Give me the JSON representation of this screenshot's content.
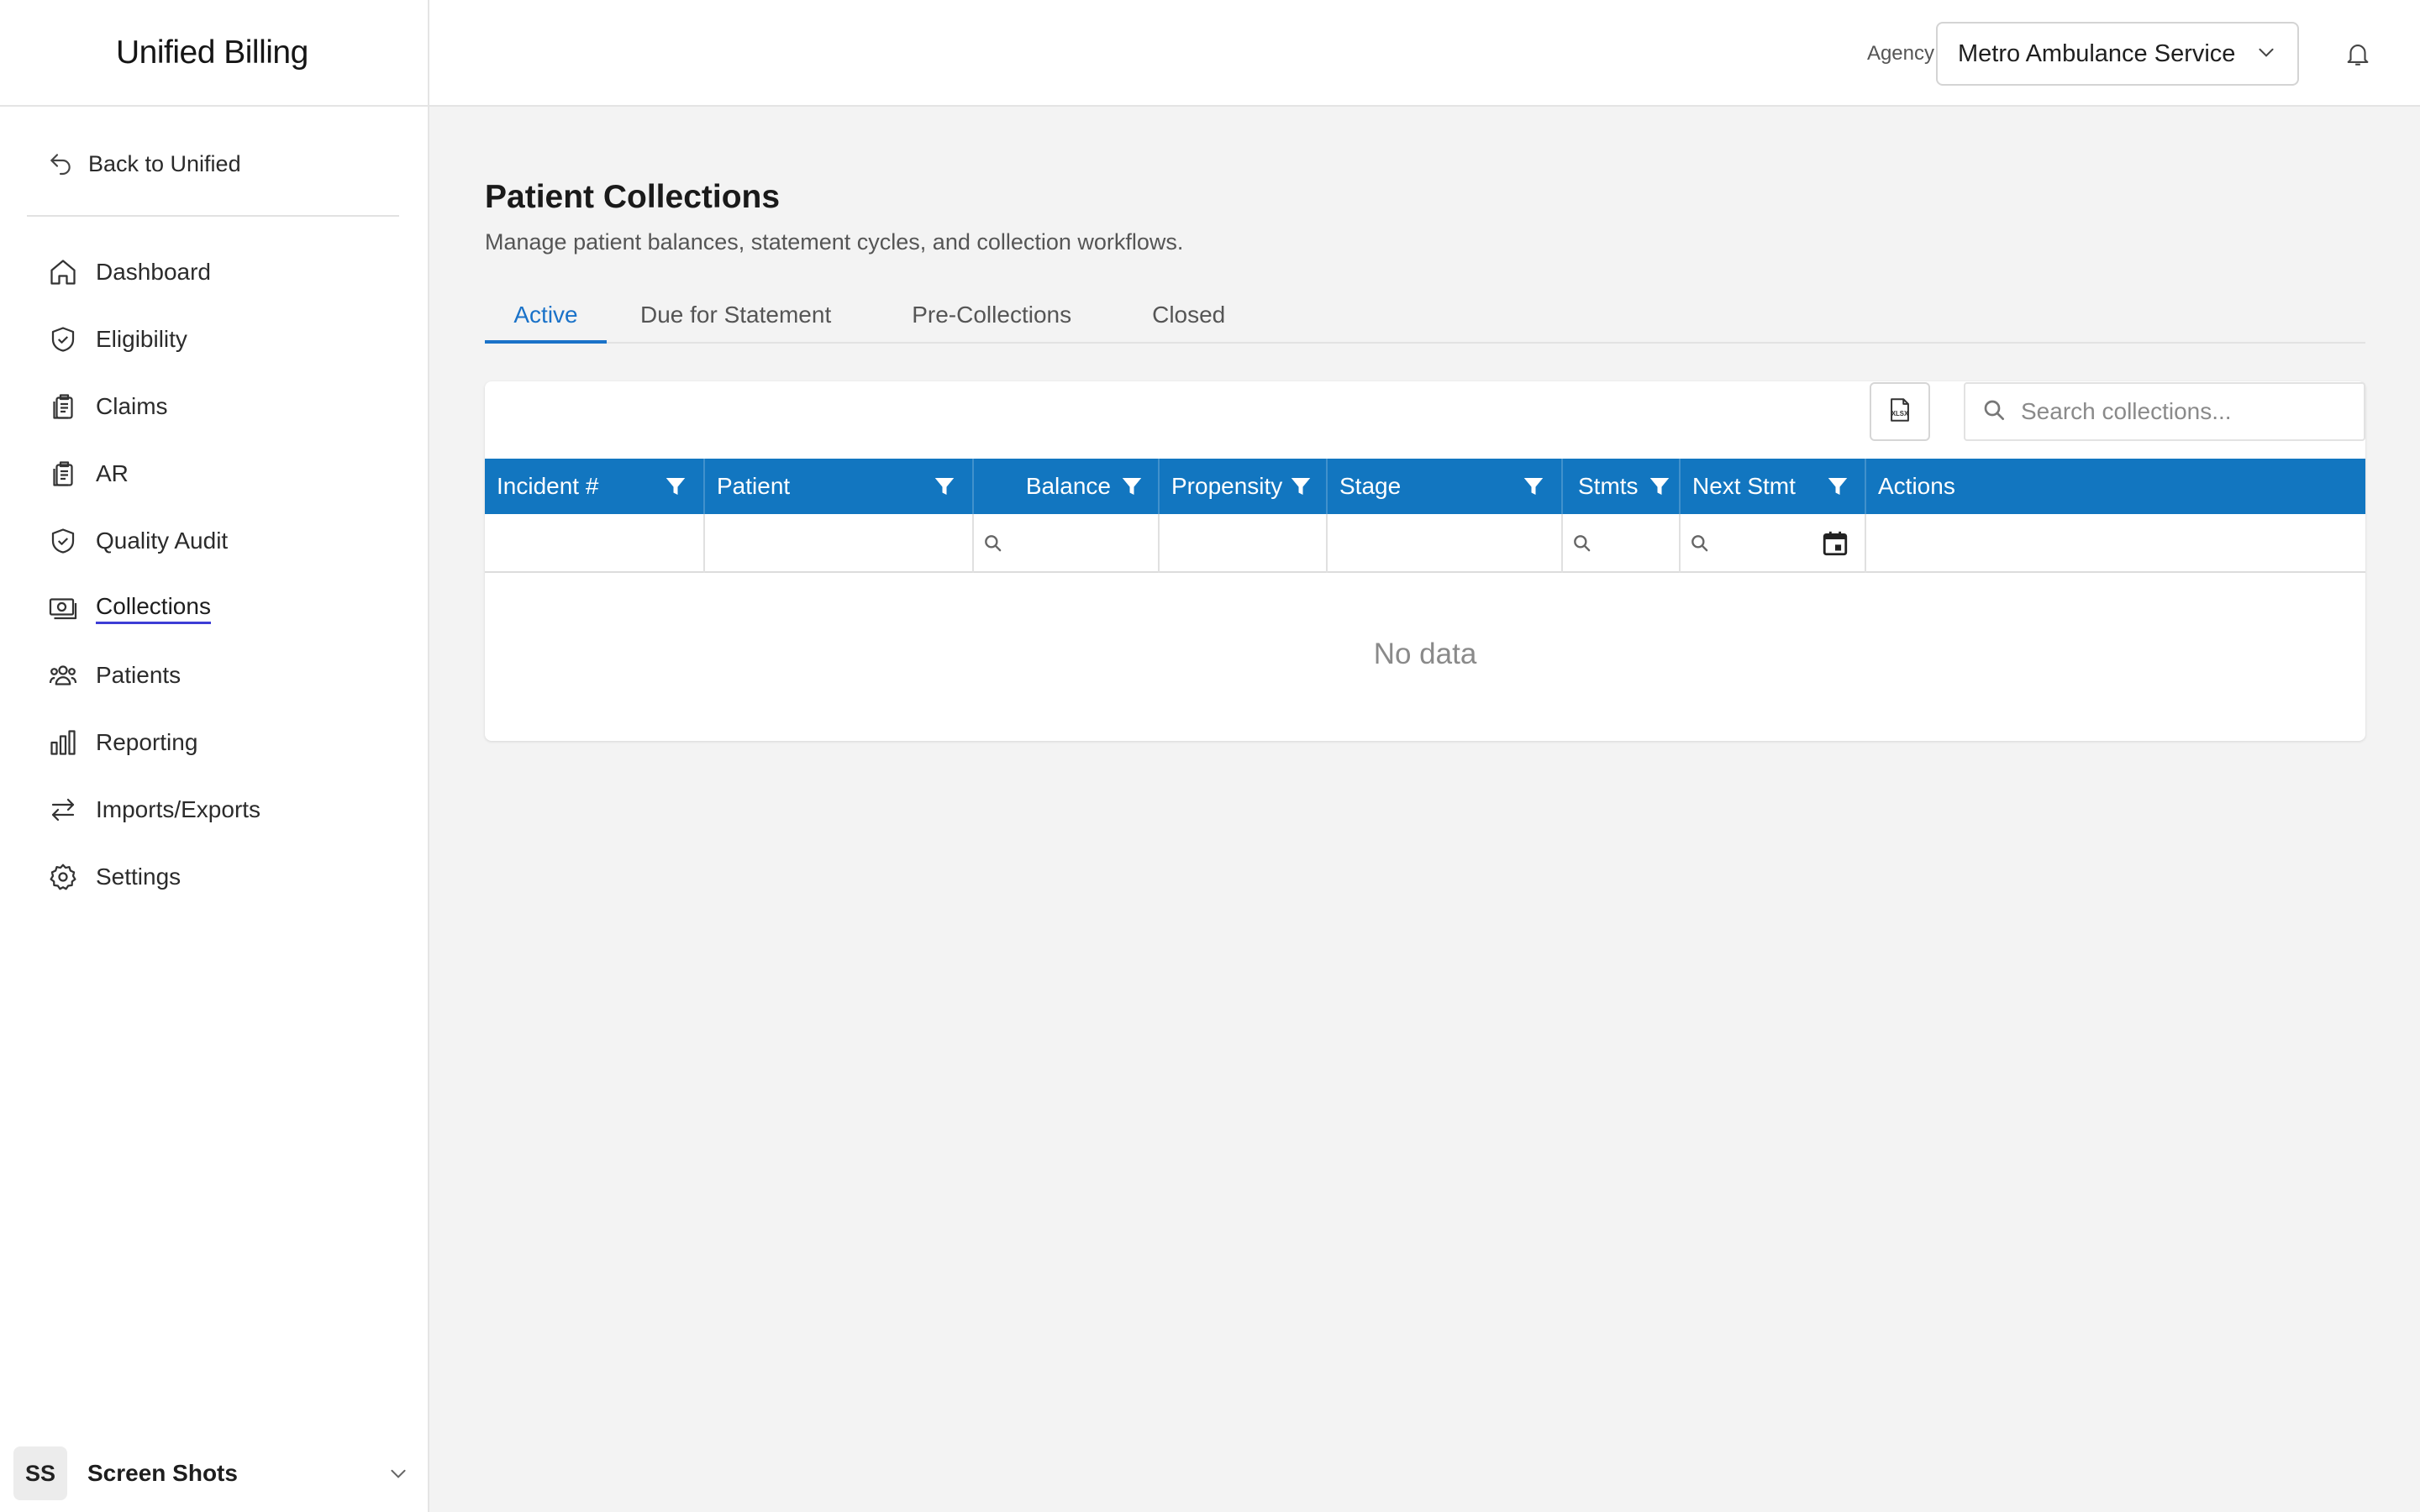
{
  "app": {
    "title": "Unified Billing"
  },
  "sidebar": {
    "back_label": "Back to Unified",
    "items": [
      {
        "label": "Dashboard",
        "icon": "home-icon"
      },
      {
        "label": "Eligibility",
        "icon": "shield-check-icon"
      },
      {
        "label": "Claims",
        "icon": "clipboard-icon"
      },
      {
        "label": "AR",
        "icon": "clipboard-icon"
      },
      {
        "label": "Quality Audit",
        "icon": "shield-check-icon"
      },
      {
        "label": "Collections",
        "icon": "money-icon",
        "active": true
      },
      {
        "label": "Patients",
        "icon": "users-icon"
      },
      {
        "label": "Reporting",
        "icon": "bar-chart-icon"
      },
      {
        "label": "Imports/Exports",
        "icon": "arrows-icon"
      },
      {
        "label": "Settings",
        "icon": "gear-icon"
      }
    ],
    "user": {
      "initials": "SS",
      "name": "Screen Shots"
    }
  },
  "topbar": {
    "agency_label": "Agency",
    "agency_value": "Metro Ambulance Service"
  },
  "page": {
    "title": "Patient Collections",
    "subtitle": "Manage patient balances, statement cycles, and collection workflows."
  },
  "tabs": [
    {
      "label": "Active",
      "active": true
    },
    {
      "label": "Due for Statement"
    },
    {
      "label": "Pre-Collections"
    },
    {
      "label": "Closed"
    }
  ],
  "toolbar": {
    "export_icon": "xlsx-export-icon",
    "search_placeholder": "Search collections..."
  },
  "grid": {
    "columns": [
      "Incident #",
      "Patient",
      "Balance",
      "Propensity",
      "Stage",
      "Stmts",
      "Next Stmt",
      "Actions"
    ],
    "empty_text": "No data"
  },
  "colors": {
    "accent": "#1276c0",
    "tab_active": "#1a72c8",
    "nav_underline": "#3d3dd6"
  }
}
